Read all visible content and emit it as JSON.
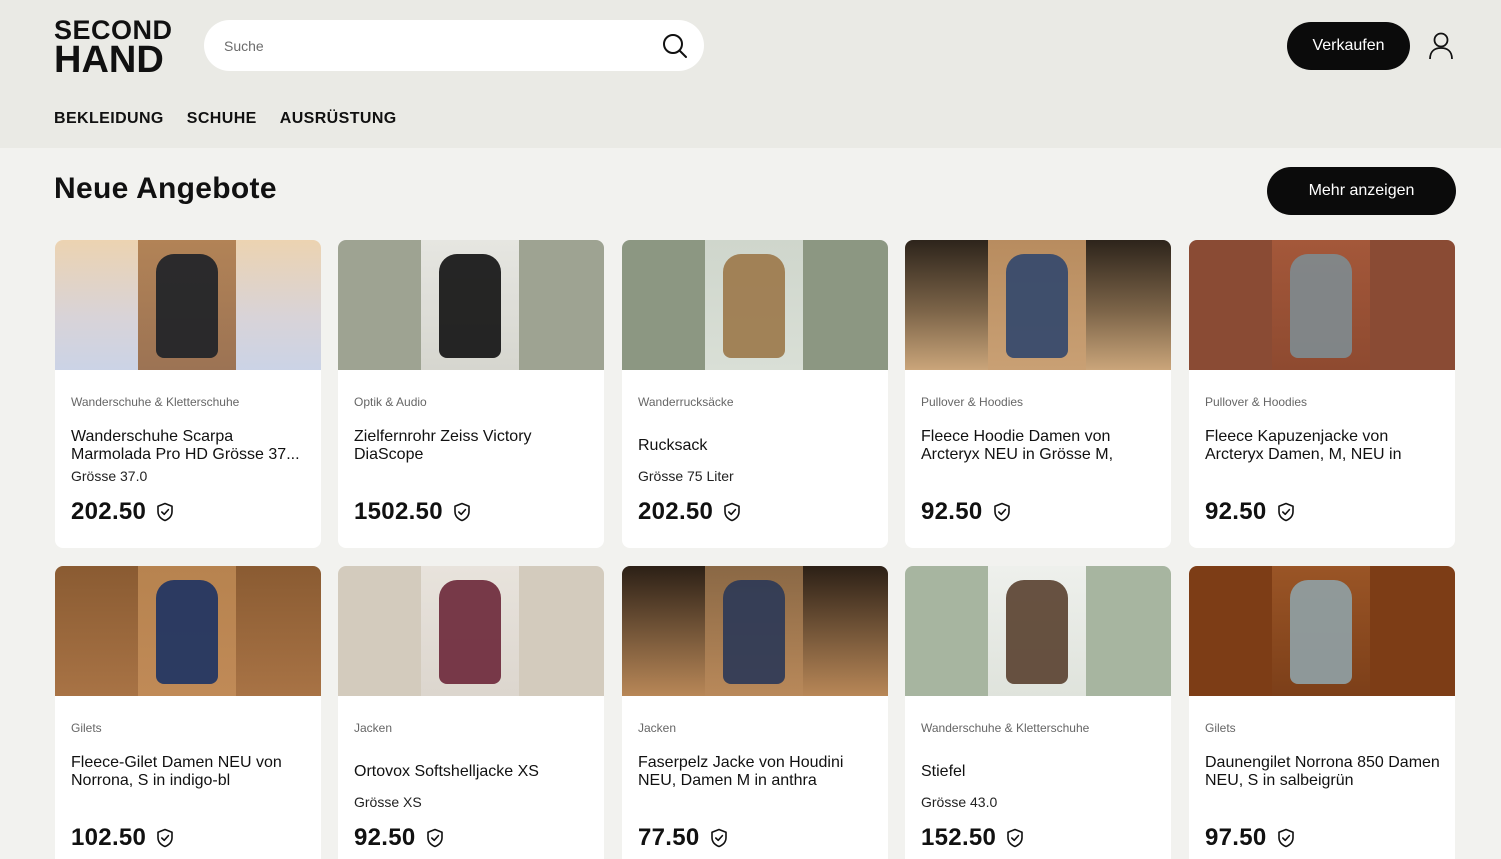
{
  "header": {
    "logo_line1": "SECOND",
    "logo_line2": "HAND",
    "search_placeholder": "Suche",
    "sell_label": "Verkaufen"
  },
  "nav": [
    "BEKLEIDUNG",
    "SCHUHE",
    "AUSRÜSTUNG"
  ],
  "section": {
    "title": "Neue Angebote",
    "more_label": "Mehr anzeigen"
  },
  "products": [
    {
      "category": "Wanderschuhe & Kletterschuhe",
      "title": "Wanderschuhe Scarpa Marmolada Pro HD Grösse 37...",
      "size": "Grösse 37.0",
      "price": "202.50",
      "img_bg": "linear-gradient(180deg,#ecd3b1 0%,#d8d3d8 60%,#cbd3e6 100%)",
      "img_fg": "linear-gradient(180deg,#b28356,#9c7354)",
      "item_color": "#1f2328"
    },
    {
      "category": "Optik & Audio",
      "title": "Zielfernrohr Zeiss Victory DiaScope",
      "size": "",
      "price": "1502.50",
      "img_bg": "#9ea392",
      "img_fg": "linear-gradient(180deg,#e6e6e1,#d6d6cf)",
      "item_color": "#151515"
    },
    {
      "category": "Wanderrucksäcke",
      "title": "Rucksack",
      "size": "Grösse 75 Liter",
      "price": "202.50",
      "img_bg": "#8c9782",
      "img_fg": "linear-gradient(180deg,#cfd6cc,#d9dfd6)",
      "item_color": "#9c7a4c"
    },
    {
      "category": "Pullover & Hoodies",
      "title": "Fleece Hoodie Damen von Arcteryx NEU in Grösse M,",
      "size": "",
      "price": "92.50",
      "img_bg": "linear-gradient(180deg,#2d241b 0%,#7d6549 55%,#caa57a 100%)",
      "img_fg": "linear-gradient(180deg,#b88c5f,#c9a074)",
      "item_color": "#34496d"
    },
    {
      "category": "Pullover & Hoodies",
      "title": "Fleece Kapuzenjacke von Arcteryx Damen, M, NEU in",
      "size": "",
      "price": "92.50",
      "img_bg": "#8a4b34",
      "img_fg": "linear-gradient(180deg,#a4583a,#8e4a30)",
      "item_color": "#7f8a8e"
    },
    {
      "category": "Gilets",
      "title": "Fleece-Gilet Damen NEU von Norrona, S in indigo-bl",
      "size": "",
      "price": "102.50",
      "img_bg": "linear-gradient(180deg,#8a5b32,#a87345)",
      "img_fg": "linear-gradient(180deg,#b7834f,#c08a57)",
      "item_color": "#1f3463"
    },
    {
      "category": "Jacken",
      "title": "Ortovox Softshelljacke XS",
      "size": "Grösse XS",
      "price": "92.50",
      "img_bg": "#d3cbbd",
      "img_fg": "linear-gradient(180deg,#e8e3dc,#dcd6ce)",
      "item_color": "#6e2a3c"
    },
    {
      "category": "Jacken",
      "title": "Faserpelz Jacke von Houdini NEU, Damen M in anthra",
      "size": "",
      "price": "77.50",
      "img_bg": "linear-gradient(180deg,#2c2016 0%,#7a5a3b 55%,#b88757 100%)",
      "img_fg": "linear-gradient(180deg,#8a6845,#b9895a)",
      "item_color": "#2e3a57"
    },
    {
      "category": "Wanderschuhe & Kletterschuhe",
      "title": "Stiefel",
      "size": "Grösse 43.0",
      "price": "152.50",
      "img_bg": "#a7b5a0",
      "img_fg": "linear-gradient(180deg,#eef0ec,#dfe3dc)",
      "item_color": "#5b4332"
    },
    {
      "category": "Gilets",
      "title": "Daunengilet Norrona 850 Damen NEU, S in salbeigrün",
      "size": "",
      "price": "97.50",
      "img_bg": "#7d3d16",
      "img_fg": "linear-gradient(180deg,#9a5526,#7c3f19)",
      "item_color": "#8fa0a4"
    }
  ]
}
